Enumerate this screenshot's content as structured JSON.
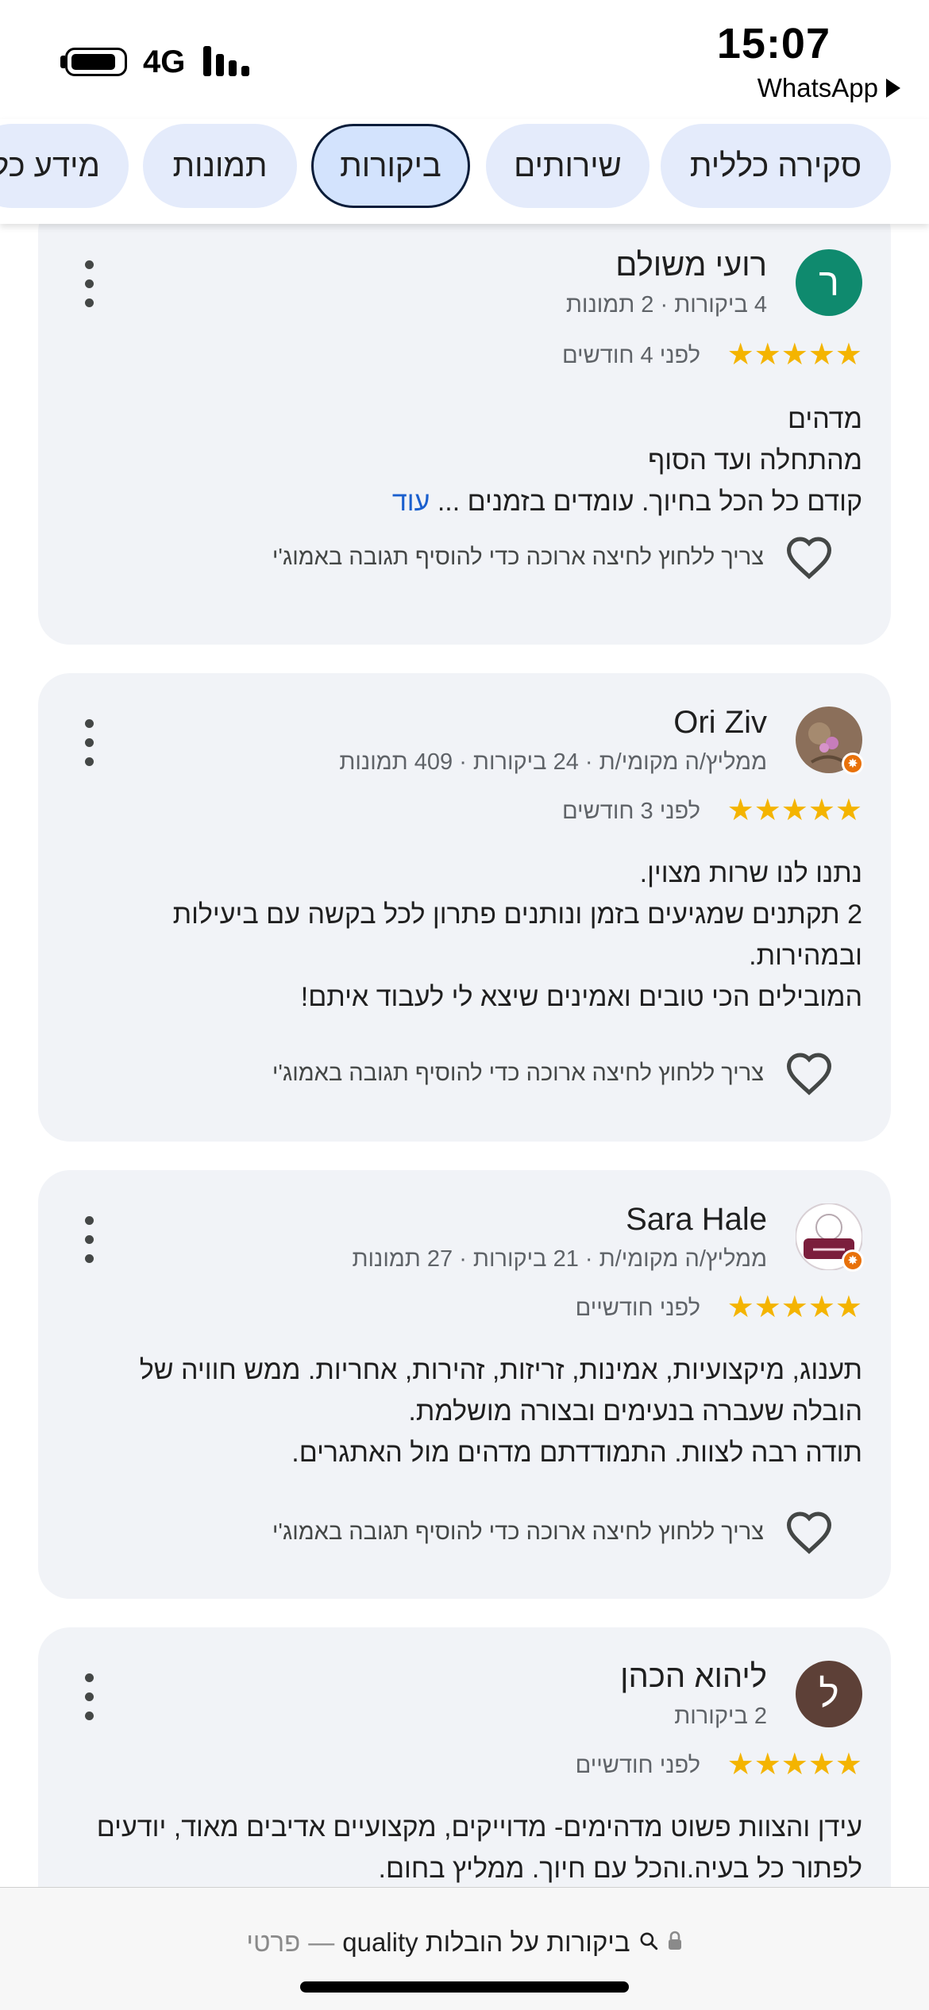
{
  "status_bar": {
    "time": "15:07",
    "back_app": "WhatsApp",
    "network": "4G"
  },
  "tabs": [
    {
      "label": "סקירה כללית",
      "active": false
    },
    {
      "label": "שירותים",
      "active": false
    },
    {
      "label": "ביקורות",
      "active": true
    },
    {
      "label": "תמונות",
      "active": false
    },
    {
      "label": "מידע כל",
      "active": false
    }
  ],
  "reviews": [
    {
      "avatar_letter": "ר",
      "avatar_color": "#0f8a6e",
      "name": "רועי משולם",
      "meta": "4 ביקורות · 2 תמונות",
      "rating": 5,
      "date": "לפני 4 חודשים",
      "lines": [
        "מדהים",
        "מהתחלה ועד הסוף",
        "קודם כל הכל בחיוך. עומדים בזמנים ..."
      ],
      "more_label": "עוד",
      "reply_hint": "צריך ללחוץ לחיצה ארוכה כדי להוסיף תגובה באמוג'י"
    },
    {
      "avatar_letter": "",
      "avatar_color": "#8b6f5a",
      "name": "Ori Ziv",
      "meta": "ממליץ/ה מקומי/ת · 24 ביקורות · 409 תמונות",
      "rating": 5,
      "date": "לפני 3 חודשים",
      "lines": [
        "נתנו לנו שרות מצוין.",
        "2 תקתנים שמגיעים בזמן ונותנים פתרון לכל בקשה עם ביעילות",
        "ובמהירות.",
        "המובילים הכי טובים ואמינים שיצא לי לעבוד איתם!"
      ],
      "reply_hint": "צריך ללחוץ לחיצה ארוכה כדי להוסיף תגובה באמוג'י"
    },
    {
      "avatar_letter": "",
      "avatar_color": "#7b1e3c",
      "name": "Sara Hale",
      "meta": "ממליץ/ה מקומי/ת · 21 ביקורות · 27 תמונות",
      "rating": 5,
      "date": "לפני חודשיים",
      "lines": [
        "תענוג, מיקצועיות, אמינות, זריזות, זהירות, אחריות. ממש חוויה של",
        "הובלה שעברה בנעימים ובצורה מושלמת.",
        "תודה רבה לצוות. התמודדתם מדהים מול האתגרים."
      ],
      "reply_hint": "צריך ללחוץ לחיצה ארוכה כדי להוסיף תגובה באמוג'י"
    },
    {
      "avatar_letter": "ל",
      "avatar_color": "#5d4037",
      "name": "ליהוא הכהן",
      "meta": "2 ביקורות",
      "rating": 5,
      "date": "לפני חודשיים",
      "lines": [
        "עידן והצוות פשוט מדהימים- מדוייקים, מקצועיים אדיבים מאוד, יודעים",
        "לפתור כל בעיה.והכל עם חיוך. ממליץ בחום."
      ],
      "reply_hint": ""
    }
  ],
  "url_bar": {
    "text": "ביקורות על הובלות quality",
    "separator": "—",
    "mode": "פרטי"
  }
}
